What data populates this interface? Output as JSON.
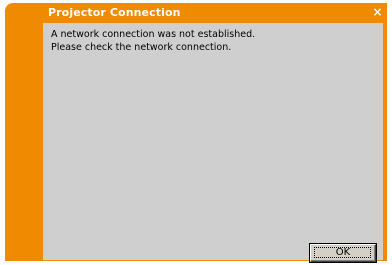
{
  "window": {
    "title": "Projector Connection",
    "close_glyph": "×",
    "accent_color": "#f08a00",
    "client_color": "#cfcfcf"
  },
  "message": {
    "line1": "A network connection was not established.",
    "line2": "Please check the network connection."
  },
  "buttons": {
    "ok_label": "OK"
  },
  "icons": {
    "close": "close-icon"
  }
}
